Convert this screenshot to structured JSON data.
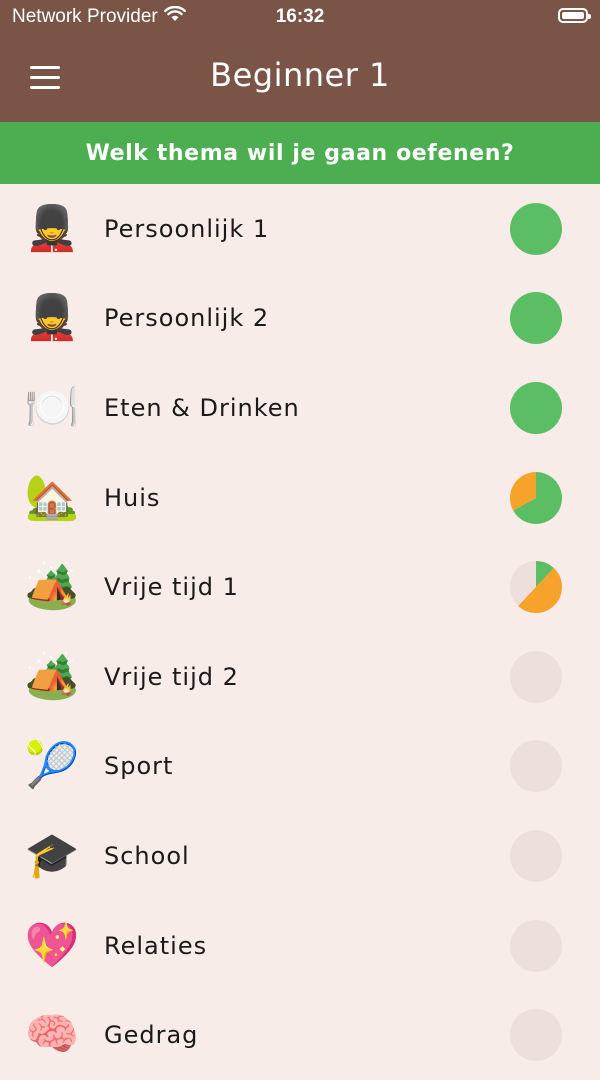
{
  "status_bar": {
    "carrier": "Network Provider",
    "time": "16:32"
  },
  "header": {
    "title": "Beginner 1"
  },
  "banner": {
    "text": "Welk thema wil je gaan oefenen?"
  },
  "colors": {
    "header_bg": "#7A5447",
    "banner_bg": "#4CAE50",
    "list_bg": "#F7ECE7",
    "progress_green": "#5BBE64",
    "progress_orange": "#F7A22A",
    "progress_empty": "#EDE0DC"
  },
  "themes": [
    {
      "label": "Persoonlijk 1",
      "icon": "guard-icon",
      "emoji": "💂",
      "progress": {
        "green": 1.0,
        "orange": 0.0
      }
    },
    {
      "label": "Persoonlijk 2",
      "icon": "guard-icon",
      "emoji": "💂",
      "progress": {
        "green": 1.0,
        "orange": 0.0
      }
    },
    {
      "label": "Eten & Drinken",
      "icon": "plate-fork-knife-icon",
      "emoji": "🍽️",
      "progress": {
        "green": 1.0,
        "orange": 0.0
      }
    },
    {
      "label": "Huis",
      "icon": "house-garden-icon",
      "emoji": "🏡",
      "progress": {
        "green": 0.67,
        "orange": 0.33
      }
    },
    {
      "label": "Vrije tijd 1",
      "icon": "camping-icon",
      "emoji": "🏕️",
      "progress": {
        "green": 0.12,
        "orange": 0.5
      }
    },
    {
      "label": "Vrije tijd 2",
      "icon": "camping-icon",
      "emoji": "🏕️",
      "progress": {
        "green": 0.0,
        "orange": 0.0
      }
    },
    {
      "label": "Sport",
      "icon": "tennis-ball-icon",
      "emoji": "🎾",
      "progress": {
        "green": 0.0,
        "orange": 0.0
      }
    },
    {
      "label": "School",
      "icon": "graduation-cap-icon",
      "emoji": "🎓",
      "progress": {
        "green": 0.0,
        "orange": 0.0
      }
    },
    {
      "label": "Relaties",
      "icon": "sparkling-heart-icon",
      "emoji": "💖",
      "progress": {
        "green": 0.0,
        "orange": 0.0
      }
    },
    {
      "label": "Gedrag",
      "icon": "brain-icon",
      "emoji": "🧠",
      "progress": {
        "green": 0.0,
        "orange": 0.0
      }
    }
  ]
}
